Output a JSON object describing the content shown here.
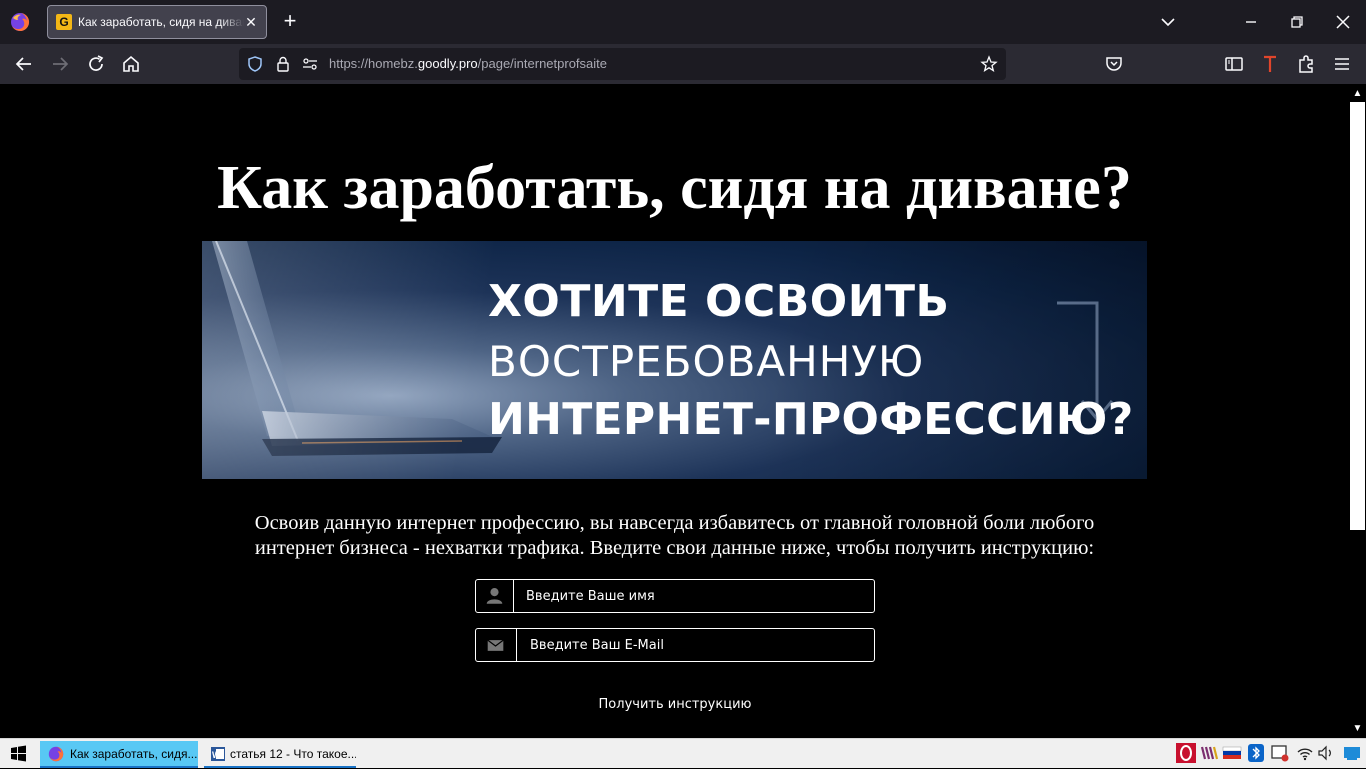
{
  "browser": {
    "tab": {
      "title": "Как заработать, сидя на диване?",
      "favicon_letter": "G"
    },
    "url": {
      "prefix": "https://homebz.",
      "domain": "goodly.pro",
      "path": "/page/internetprofsaite"
    }
  },
  "page": {
    "headline": "Как заработать, сидя на диване?",
    "banner": {
      "line1": "ХОТИТЕ ОСВОИТЬ",
      "line2": "ВОСТРЕБОВАННУЮ",
      "line3": "ИНТЕРНЕТ-ПРОФЕССИЮ?"
    },
    "description_line1": "Освоив данную интернет профессию, вы навсегда избавитесь от главной головной боли любого",
    "description_line2": "интернет бизнеса - нехватки трафика. Введите свои данные ниже, чтобы получить инструкцию:",
    "form": {
      "name_placeholder": "Введите Ваше имя",
      "email_placeholder": "Введите Ваш E-Mail",
      "submit_label": "Получить инструкцию"
    }
  },
  "taskbar": {
    "items": [
      {
        "label": "Как заработать, сидя...",
        "app": "firefox-icon",
        "active": true
      },
      {
        "label": "статья 12 - Что такое...",
        "app": "word-icon",
        "active": false
      }
    ]
  },
  "colors": {
    "page_bg": "#000000",
    "chrome_dark": "#1c1b22",
    "chrome_toolbar": "#2b2a33",
    "banner_blue": "#0d2446",
    "taskbar_active": "#58c8f4"
  }
}
